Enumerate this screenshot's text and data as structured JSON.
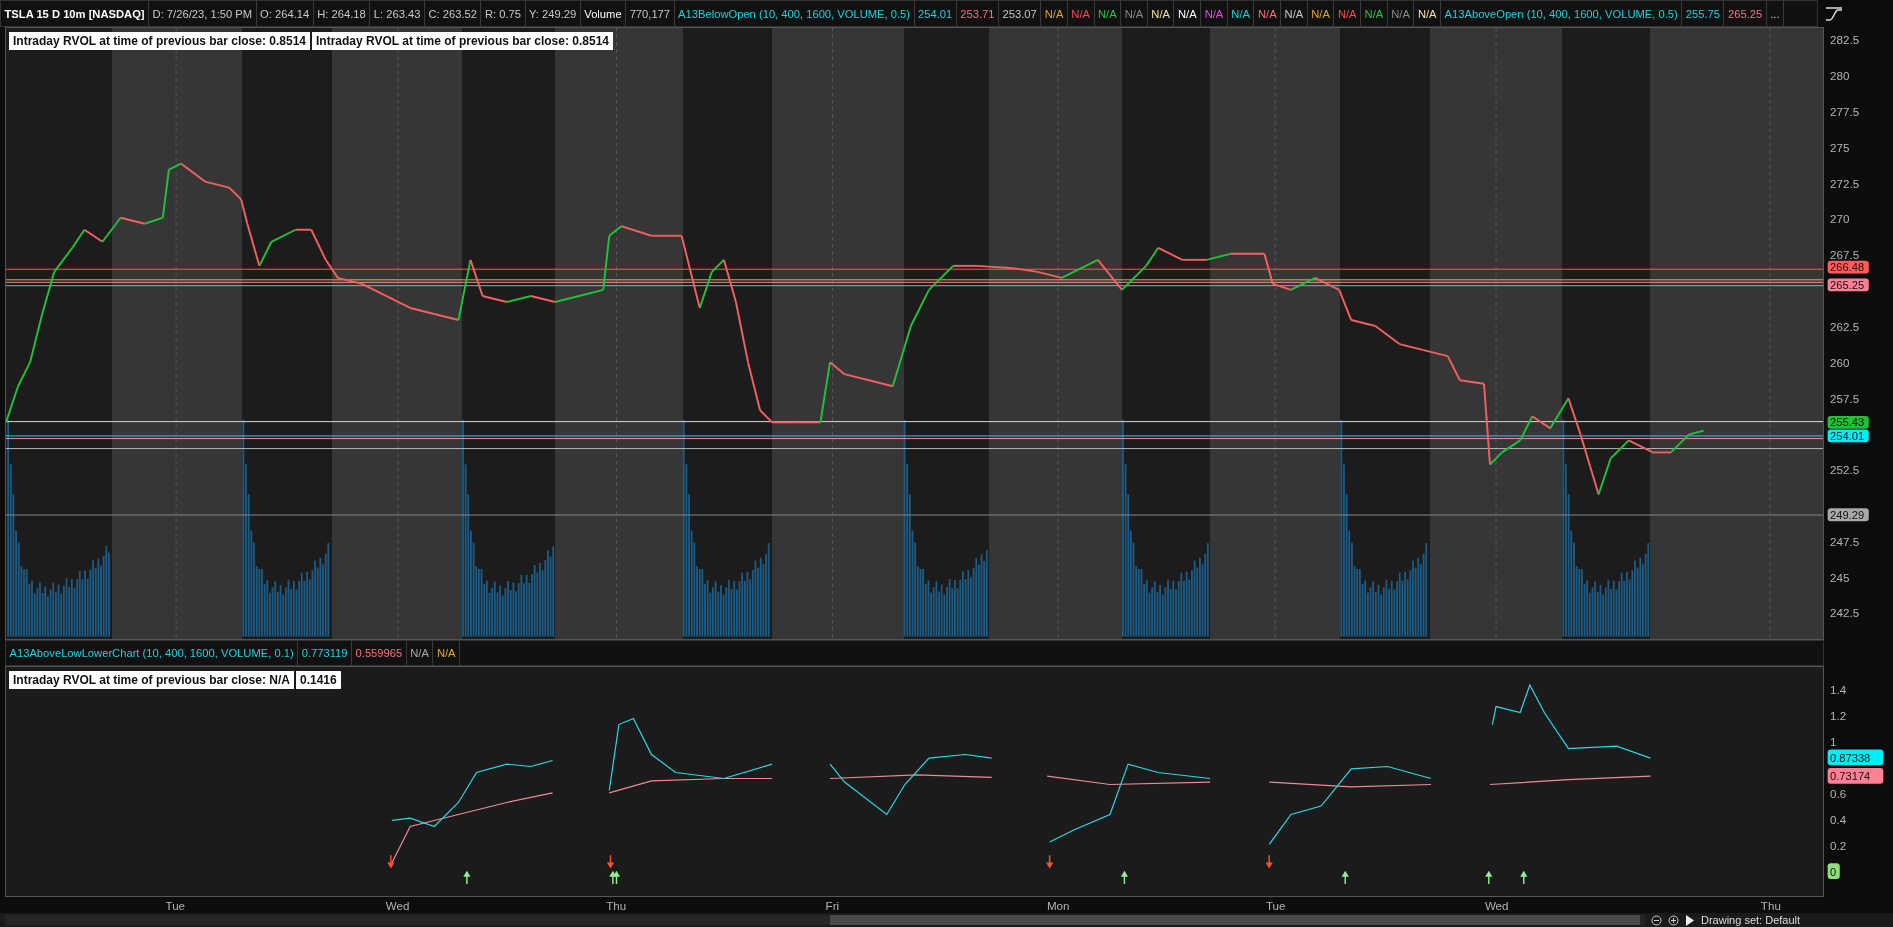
{
  "header": {
    "symbol": "TSLA 15 D 10m [NASDAQ]",
    "cells": [
      "D: 7/26/23, 1:50 PM",
      "O: 264.14",
      "H: 264.18",
      "L: 263.43",
      "C: 263.52",
      "R: 0.75",
      "Y: 249.29",
      "Volume",
      "770,177",
      "A13BelowOpen (10, 400, 1600, VOLUME, 0.5)",
      "254.01",
      "253.71",
      "253.07",
      "N/A",
      "N/A",
      "N/A",
      "N/A",
      "N/A",
      "N/A",
      "N/A",
      "N/A",
      "N/A",
      "N/A",
      "N/A",
      "N/A",
      "N/A",
      "N/A",
      "N/A",
      "A13AboveOpen (10, 400, 1600, VOLUME, 0.5)",
      "255.75",
      "265.25",
      "..."
    ]
  },
  "price_chart": {
    "labels": [
      "Intraday RVOL at time of previous bar close: 0.8514",
      "Intraday RVOL at time of previous bar close: 0.8514"
    ],
    "axis_ticks": [
      "282.5",
      "280",
      "277.5",
      "275",
      "272.5",
      "270",
      "267.5",
      "262.5",
      "260",
      "257.5",
      "252.5",
      "247.5",
      "245",
      "242.5"
    ],
    "badges": [
      {
        "text": "266.48",
        "color": "#ff5a5a"
      },
      {
        "text": "265.25",
        "color": "#ff7f95"
      },
      {
        "text": "255.43",
        "color": "#22c033"
      },
      {
        "text": "254.01",
        "color": "#00eef5"
      },
      {
        "text": "249.29",
        "color": "#a8a8a8"
      }
    ]
  },
  "lower_study": {
    "cells": [
      "A13AboveLowLowerChart (10, 400, 1600, VOLUME, 0.1)",
      "0.773119",
      "0.559965",
      "N/A",
      "N/A"
    ],
    "labels": [
      "Intraday RVOL at time of previous bar close: N/A",
      "0.1416"
    ],
    "axis_ticks": [
      "1.4",
      "1.2",
      "1",
      "0.6",
      "0.4",
      "0.2"
    ],
    "badges": [
      {
        "text": "0.87338",
        "color": "#00eef5"
      },
      {
        "text": "0.73174",
        "color": "#ff7f95"
      },
      {
        "text": "0",
        "color": "#8fe07a"
      }
    ],
    "signals": [
      {
        "kind": "down"
      },
      {
        "kind": "up"
      },
      {
        "kind": "down"
      },
      {
        "kind": "up"
      },
      {
        "kind": "up"
      },
      {
        "kind": "down"
      },
      {
        "kind": "up"
      },
      {
        "kind": "down"
      },
      {
        "kind": "up"
      },
      {
        "kind": "up"
      },
      {
        "kind": "up"
      }
    ]
  },
  "time_axis": {
    "labels": [
      "Tue",
      "Wed",
      "Thu",
      "Fri",
      "Mon",
      "Tue",
      "Wed",
      "Thu"
    ]
  },
  "footer": {
    "drawing_set": "Drawing set: Default"
  }
}
